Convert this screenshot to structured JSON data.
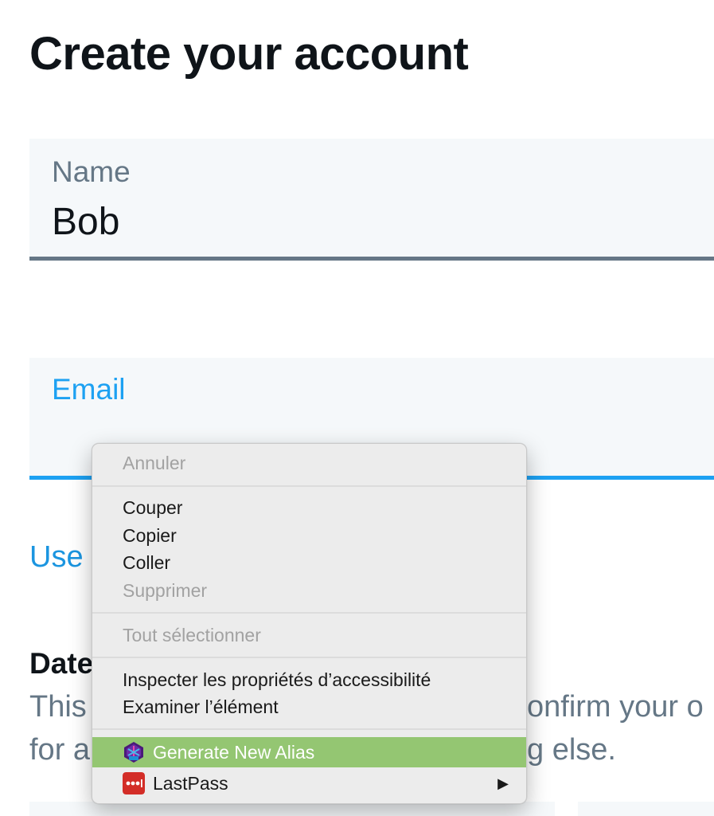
{
  "page": {
    "title": "Create your account"
  },
  "form": {
    "name_field": {
      "label": "Name",
      "value": "Bob"
    },
    "email_field": {
      "label": "Email",
      "value": ""
    },
    "use_link_partial": "Use",
    "dob": {
      "heading_partial": "Date",
      "line1_left": "This",
      "line1_right": "onfirm your o",
      "line2_left": "for a",
      "line2_right": "g else."
    }
  },
  "context_menu": {
    "items": [
      {
        "label": "Annuler",
        "disabled": true
      },
      {
        "label": "Couper",
        "disabled": false
      },
      {
        "label": "Copier",
        "disabled": false
      },
      {
        "label": "Coller",
        "disabled": false
      },
      {
        "label": "Supprimer",
        "disabled": true
      },
      {
        "label": "Tout sélectionner",
        "disabled": true
      },
      {
        "label": "Inspecter les propriétés d’accessibilité",
        "disabled": false
      },
      {
        "label": "Examiner l’élément",
        "disabled": false
      },
      {
        "label": "Generate New Alias",
        "disabled": false,
        "highlighted": true,
        "icon": "simplelogin-icon"
      },
      {
        "label": "LastPass",
        "disabled": false,
        "icon": "lastpass-icon",
        "submenu_arrow": "▶"
      }
    ]
  },
  "colors": {
    "link_blue": "#1da1f2",
    "text_dark": "#0f1419",
    "text_gray": "#657786",
    "field_bg": "#f5f8fa",
    "menu_highlight": "#94c672",
    "lastpass_red": "#d32d27"
  }
}
